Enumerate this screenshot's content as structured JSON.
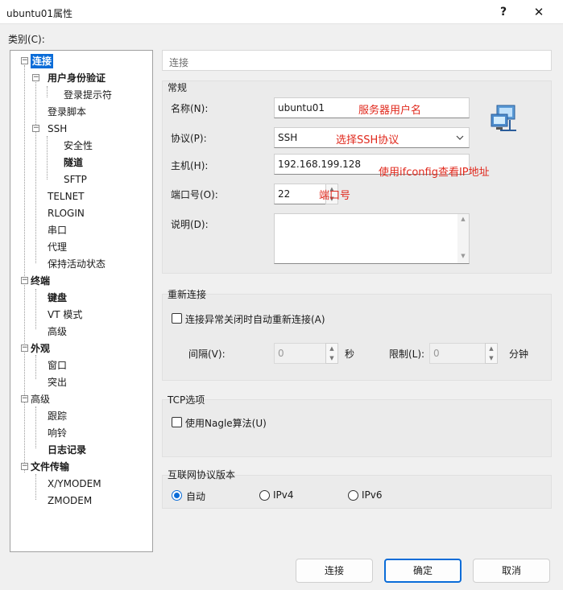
{
  "window": {
    "title": "ubuntu01属性",
    "help_glyph": "?",
    "close_glyph": "✕"
  },
  "category_label": "类别(C):",
  "tree": {
    "items": [
      {
        "label": "连接"
      },
      {
        "label": "用户身份验证"
      },
      {
        "label": "登录提示符"
      },
      {
        "label": "登录脚本"
      },
      {
        "label": "SSH"
      },
      {
        "label": "安全性"
      },
      {
        "label": "隧道"
      },
      {
        "label": "SFTP"
      },
      {
        "label": "TELNET"
      },
      {
        "label": "RLOGIN"
      },
      {
        "label": "串口"
      },
      {
        "label": "代理"
      },
      {
        "label": "保持活动状态"
      },
      {
        "label": "终端"
      },
      {
        "label": "键盘"
      },
      {
        "label": "VT 模式"
      },
      {
        "label": "高级"
      },
      {
        "label": "外观"
      },
      {
        "label": "窗口"
      },
      {
        "label": "突出"
      },
      {
        "label": "高级"
      },
      {
        "label": "跟踪"
      },
      {
        "label": "响铃"
      },
      {
        "label": "日志记录"
      },
      {
        "label": "文件传输"
      },
      {
        "label": "X/YMODEM"
      },
      {
        "label": "ZMODEM"
      }
    ],
    "toggle_minus": "−"
  },
  "breadcrumb": "连接",
  "general": {
    "title": "常规",
    "name_label": "名称(N):",
    "name_value": "ubuntu01",
    "name_annotation": "服务器用户名",
    "protocol_label": "协议(P):",
    "protocol_value": "SSH",
    "protocol_annotation": "选择SSH协议",
    "host_label": "主机(H):",
    "host_value": "192.168.199.128",
    "host_annotation": "使用ifconfig查看IP地址",
    "port_label": "端口号(O):",
    "port_value": "22",
    "port_annotation": "端口号",
    "desc_label": "说明(D):",
    "desc_value": ""
  },
  "reconnect": {
    "title": "重新连接",
    "checkbox_label": "连接异常关闭时自动重新连接(A)",
    "interval_label": "间隔(V):",
    "interval_value": "0",
    "interval_unit": "秒",
    "limit_label": "限制(L):",
    "limit_value": "0",
    "limit_unit": "分钟"
  },
  "tcp": {
    "title": "TCP选项",
    "nagle_label": "使用Nagle算法(U)"
  },
  "ip_version": {
    "title": "互联网协议版本",
    "options": [
      "自动",
      "IPv4",
      "IPv6"
    ],
    "selected": "自动"
  },
  "buttons": {
    "connect": "连接",
    "ok": "确定",
    "cancel": "取消"
  },
  "colors": {
    "accent": "#0a6cd8",
    "annotation": "#e0281c"
  }
}
